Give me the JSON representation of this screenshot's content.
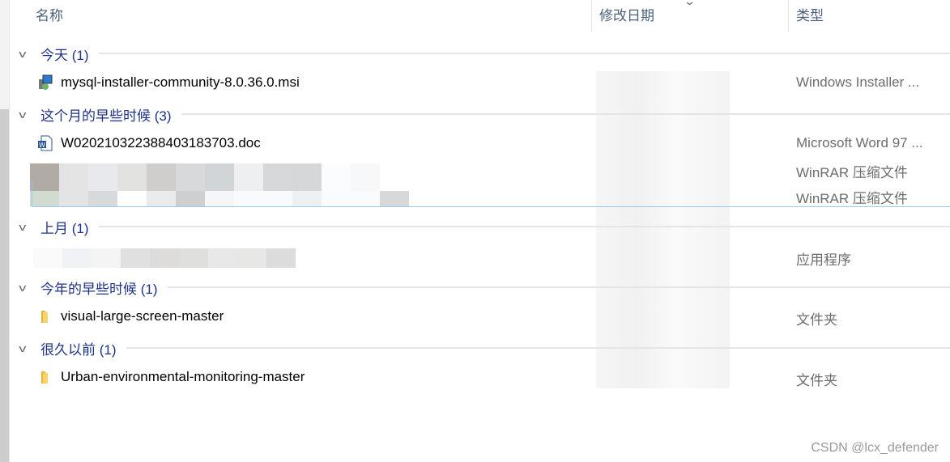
{
  "columns": {
    "name": "名称",
    "modified": "修改日期",
    "type": "类型"
  },
  "groups": [
    {
      "label": "今天 (1)",
      "files": [
        {
          "name": "mysql-installer-community-8.0.36.0.msi",
          "type": "Windows Installer ...",
          "icon": "msi-installer-icon"
        }
      ]
    },
    {
      "label": "这个月的早些时候 (3)",
      "files": [
        {
          "name": "W020210322388403183703.doc",
          "type": "Microsoft Word 97 ...",
          "icon": "word-doc-icon"
        },
        {
          "name": "",
          "type": "WinRAR 压缩文件",
          "icon": "blurred"
        },
        {
          "name": "",
          "type": "WinRAR 压缩文件",
          "icon": "blurred",
          "focused": true
        }
      ]
    },
    {
      "label": "上月 (1)",
      "files": [
        {
          "name": "",
          "type": "应用程序",
          "icon": "blurred"
        }
      ]
    },
    {
      "label": "今年的早些时候 (1)",
      "files": [
        {
          "name": "visual-large-screen-master",
          "type": "文件夹",
          "icon": "folder-icon"
        }
      ]
    },
    {
      "label": "很久以前 (1)",
      "files": [
        {
          "name": "Urban-environmental-monitoring-master",
          "type": "文件夹",
          "icon": "folder-icon"
        }
      ]
    }
  ],
  "watermark": "CSDN @lcx_defender"
}
